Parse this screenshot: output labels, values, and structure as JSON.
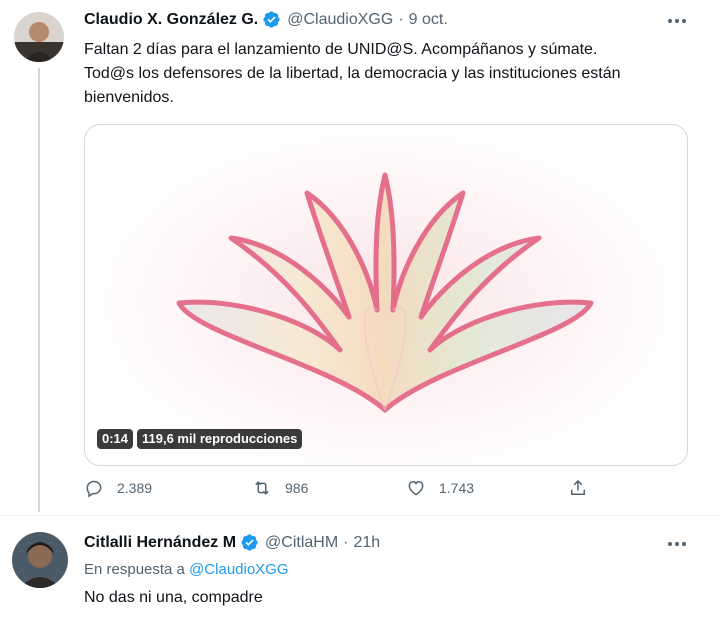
{
  "tweets": [
    {
      "author_name": "Claudio X. González G.",
      "handle": "@ClaudioXGG",
      "separator": "·",
      "time": "9 oct.",
      "text_lines": [
        "Faltan 2 días para el lanzamiento de UNID@S. Acompáñanos y súmate.",
        "Tod@s los defensores de la libertad, la democracia y las instituciones están",
        "bienvenidos."
      ],
      "video": {
        "duration": "0:14",
        "views": "119,6 mil reproducciones"
      },
      "stats": {
        "replies": "2.389",
        "retweets": "986",
        "likes": "1.743"
      }
    },
    {
      "author_name": "Citlalli Hernández M",
      "handle": "@CitlaHM",
      "separator": "·",
      "time": "21h",
      "reply_prefix": "En respuesta a",
      "reply_handle": "@ClaudioXGG",
      "text": "No das ni una, compadre"
    }
  ],
  "colors": {
    "verified": "#1d9bf0",
    "link": "#1d9bf0",
    "muted": "#536471",
    "logo_outline": "#e05a7a"
  },
  "icons": [
    "more-icon",
    "verified-badge-icon",
    "reply-icon",
    "retweet-icon",
    "like-icon",
    "share-icon"
  ]
}
